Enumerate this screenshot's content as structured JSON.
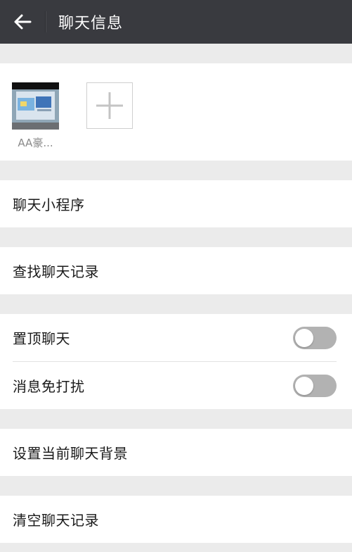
{
  "header": {
    "title": "聊天信息",
    "back_icon": "arrow-left-icon",
    "background": "#393a3f"
  },
  "members": {
    "items": [
      {
        "name": "AA豪...",
        "avatar_icon": "contact-avatar"
      }
    ],
    "add_icon": "plus-icon"
  },
  "menu": {
    "mini_programs": "聊天小程序",
    "search_history": "查找聊天记录",
    "pin_chat": {
      "label": "置顶聊天",
      "enabled": false
    },
    "mute": {
      "label": "消息免打扰",
      "enabled": false
    },
    "set_background": "设置当前聊天背景",
    "clear_history": "清空聊天记录"
  },
  "colors": {
    "page_background": "#ebebeb",
    "toggle_off": "#b2b2b2"
  }
}
